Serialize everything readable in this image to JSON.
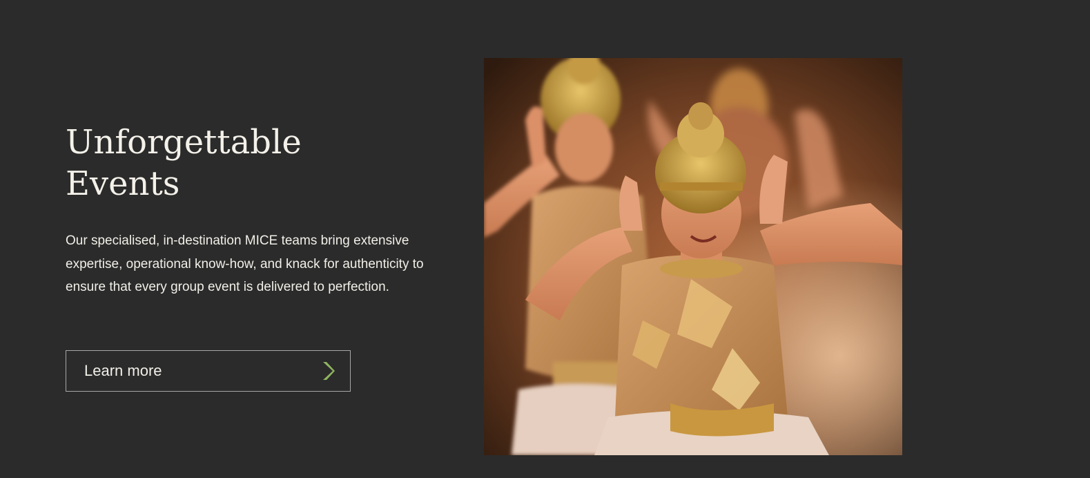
{
  "section": {
    "title_lines": [
      "Unforgettable",
      "Events"
    ],
    "description": "Our specialised, in-destination MICE teams bring extensive expertise, operational know-how, and knack for authenticity to ensure that every group event is delivered to perfection.",
    "cta": {
      "label": "Learn more",
      "icon": "chevron-right-icon"
    },
    "image": {
      "subject": "dancers-photo"
    }
  },
  "colors": {
    "background": "#2b2b2b",
    "text": "#f1efe8",
    "cta_border": "#a8a8a8",
    "accent": "#8fb560"
  }
}
